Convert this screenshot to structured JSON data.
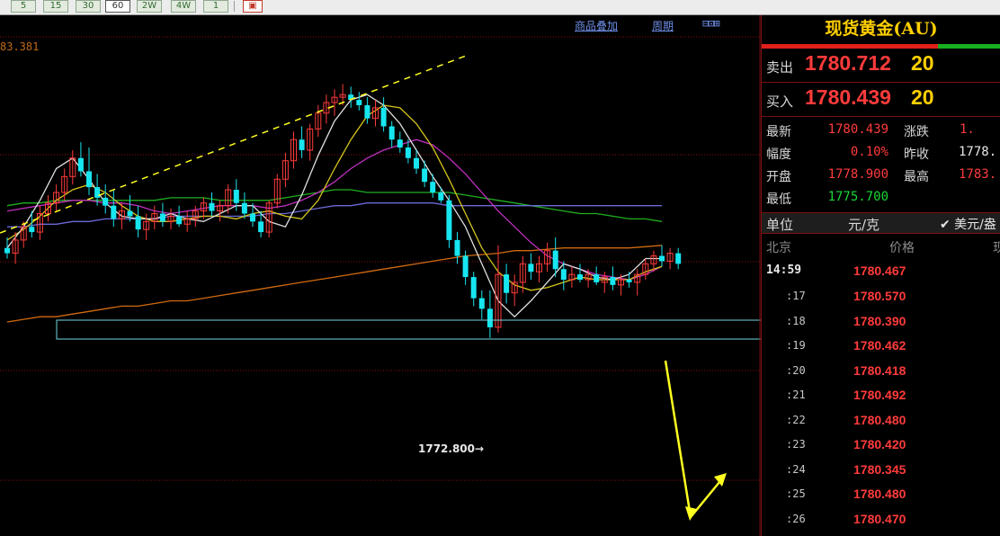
{
  "toolbar": {
    "periods": [
      "5",
      "15",
      "30",
      "60",
      "2W",
      "4W",
      "1"
    ],
    "selected": "60",
    "extra_icon": "screenshot-icon"
  },
  "chart": {
    "links": {
      "overlay": "商品叠加",
      "period": "周期"
    },
    "nav_glyphs": "⊟⊡⊞",
    "top_price_label": "83.381",
    "low_label": "1772.800→",
    "colors": {
      "up": "#ff3b3b",
      "down": "#17e6f0",
      "ma_white": "#e0e0e0",
      "ma_yellow": "#d4c41a",
      "ma_magenta": "#c030c0",
      "ma_green": "#20b020",
      "ma_blue": "#6a6ad8",
      "ma_orange": "#d06a10",
      "annotation_yellow": "#ffff20",
      "box": "#70d8e0",
      "grid": "#8a1010"
    }
  },
  "chart_data": {
    "type": "candlestick",
    "low_marker": 1772.8,
    "candles": [
      [
        1776.2,
        1776.6,
        1775.8,
        1776.0
      ],
      [
        1776.0,
        1776.8,
        1775.6,
        1776.5
      ],
      [
        1776.5,
        1777.2,
        1776.2,
        1777.0
      ],
      [
        1777.0,
        1777.6,
        1776.6,
        1776.8
      ],
      [
        1776.8,
        1777.8,
        1776.5,
        1777.5
      ],
      [
        1777.5,
        1778.2,
        1777.2,
        1777.9
      ],
      [
        1777.9,
        1778.6,
        1777.6,
        1778.3
      ],
      [
        1778.3,
        1779.2,
        1778.0,
        1778.9
      ],
      [
        1778.9,
        1779.9,
        1778.6,
        1779.6
      ],
      [
        1779.6,
        1780.2,
        1778.9,
        1779.1
      ],
      [
        1779.1,
        1780.0,
        1778.2,
        1778.5
      ],
      [
        1778.5,
        1779.0,
        1777.8,
        1778.1
      ],
      [
        1778.1,
        1778.6,
        1777.5,
        1777.8
      ],
      [
        1777.8,
        1778.4,
        1777.0,
        1777.3
      ],
      [
        1777.3,
        1777.9,
        1776.9,
        1777.6
      ],
      [
        1777.6,
        1778.2,
        1777.2,
        1777.4
      ],
      [
        1777.4,
        1777.8,
        1776.6,
        1776.9
      ],
      [
        1776.9,
        1777.5,
        1776.5,
        1777.2
      ],
      [
        1777.2,
        1777.8,
        1776.9,
        1777.5
      ],
      [
        1777.5,
        1777.9,
        1777.0,
        1777.2
      ],
      [
        1777.2,
        1777.7,
        1776.9,
        1777.4
      ],
      [
        1777.4,
        1777.8,
        1777.0,
        1777.1
      ],
      [
        1777.1,
        1777.6,
        1776.8,
        1777.3
      ],
      [
        1777.3,
        1777.8,
        1777.0,
        1777.6
      ],
      [
        1777.6,
        1778.1,
        1777.3,
        1777.9
      ],
      [
        1777.9,
        1778.3,
        1777.4,
        1777.6
      ],
      [
        1777.6,
        1778.0,
        1777.2,
        1777.8
      ],
      [
        1777.8,
        1778.6,
        1777.5,
        1778.4
      ],
      [
        1778.4,
        1778.8,
        1777.6,
        1777.9
      ],
      [
        1777.9,
        1778.3,
        1777.3,
        1777.5
      ],
      [
        1777.5,
        1777.9,
        1777.0,
        1777.2
      ],
      [
        1777.2,
        1777.6,
        1776.6,
        1776.8
      ],
      [
        1776.8,
        1778.0,
        1776.6,
        1777.9
      ],
      [
        1777.9,
        1779.0,
        1777.7,
        1778.8
      ],
      [
        1778.8,
        1779.8,
        1778.5,
        1779.5
      ],
      [
        1779.5,
        1780.6,
        1779.2,
        1780.3
      ],
      [
        1780.3,
        1780.8,
        1779.6,
        1779.9
      ],
      [
        1779.9,
        1780.9,
        1779.5,
        1780.7
      ],
      [
        1780.7,
        1781.6,
        1780.4,
        1781.3
      ],
      [
        1781.3,
        1782.0,
        1780.9,
        1781.7
      ],
      [
        1781.7,
        1782.2,
        1781.2,
        1781.9
      ],
      [
        1781.9,
        1782.4,
        1781.6,
        1782.0
      ],
      [
        1782.0,
        1782.3,
        1781.5,
        1781.8
      ],
      [
        1781.8,
        1782.1,
        1781.4,
        1781.6
      ],
      [
        1781.6,
        1781.9,
        1780.9,
        1781.1
      ],
      [
        1781.1,
        1781.8,
        1780.8,
        1781.5
      ],
      [
        1781.5,
        1781.9,
        1780.6,
        1780.8
      ],
      [
        1780.8,
        1781.0,
        1780.0,
        1780.3
      ],
      [
        1780.3,
        1780.6,
        1779.8,
        1780.0
      ],
      [
        1780.0,
        1780.3,
        1779.4,
        1779.6
      ],
      [
        1779.6,
        1779.9,
        1779.0,
        1779.2
      ],
      [
        1779.2,
        1779.5,
        1778.5,
        1778.7
      ],
      [
        1778.7,
        1779.0,
        1778.1,
        1778.3
      ],
      [
        1778.3,
        1778.5,
        1777.9,
        1778.0
      ],
      [
        1778.0,
        1778.2,
        1776.2,
        1776.5
      ],
      [
        1776.5,
        1776.8,
        1775.6,
        1775.9
      ],
      [
        1775.9,
        1776.1,
        1774.8,
        1775.1
      ],
      [
        1775.1,
        1775.3,
        1774.0,
        1774.3
      ],
      [
        1774.3,
        1774.6,
        1773.5,
        1773.9
      ],
      [
        1773.9,
        1774.6,
        1772.8,
        1773.2
      ],
      [
        1773.2,
        1776.3,
        1773.0,
        1775.2
      ],
      [
        1775.2,
        1775.6,
        1774.1,
        1774.5
      ],
      [
        1774.5,
        1775.2,
        1774.0,
        1774.9
      ],
      [
        1774.9,
        1775.9,
        1774.5,
        1775.6
      ],
      [
        1775.6,
        1776.0,
        1775.0,
        1775.3
      ],
      [
        1775.3,
        1775.9,
        1774.9,
        1775.6
      ],
      [
        1775.6,
        1776.4,
        1775.3,
        1776.1
      ],
      [
        1776.1,
        1776.6,
        1775.1,
        1775.4
      ],
      [
        1775.4,
        1775.7,
        1774.6,
        1775.0
      ],
      [
        1775.0,
        1775.5,
        1774.7,
        1775.2
      ],
      [
        1775.2,
        1775.6,
        1774.9,
        1775.0
      ],
      [
        1775.0,
        1775.4,
        1774.7,
        1775.2
      ],
      [
        1775.2,
        1775.5,
        1774.8,
        1774.9
      ],
      [
        1774.9,
        1775.3,
        1774.5,
        1775.1
      ],
      [
        1775.1,
        1775.5,
        1774.6,
        1774.8
      ],
      [
        1774.8,
        1775.2,
        1774.4,
        1775.0
      ],
      [
        1775.0,
        1775.3,
        1774.7,
        1774.9
      ],
      [
        1774.9,
        1775.4,
        1774.4,
        1775.2
      ],
      [
        1775.2,
        1775.8,
        1775.0,
        1775.6
      ],
      [
        1775.6,
        1776.1,
        1775.3,
        1775.9
      ],
      [
        1775.9,
        1776.3,
        1775.5,
        1775.7
      ],
      [
        1775.7,
        1776.2,
        1775.4,
        1776.0
      ],
      [
        1776.0,
        1776.2,
        1775.4,
        1775.6
      ]
    ],
    "ma_lines": [
      {
        "color_key": "ma_green",
        "values": [
          1777.8,
          1777.9,
          1777.9,
          1778.0,
          1778.0,
          1778.0,
          1778.0,
          1778.0,
          1778.0,
          1778.0,
          1778.1,
          1778.1,
          1778.1,
          1778.0,
          1778.0,
          1778.0,
          1778.0,
          1778.1,
          1778.2,
          1778.3,
          1778.4,
          1778.4,
          1778.3,
          1778.3,
          1778.3,
          1778.3,
          1778.3,
          1778.3,
          1778.2,
          1778.1,
          1778.0,
          1777.9,
          1777.8,
          1777.7,
          1777.6,
          1777.5,
          1777.5,
          1777.4,
          1777.3,
          1777.3,
          1777.2
        ]
      },
      {
        "color_key": "ma_blue",
        "values": [
          1777.0,
          1777.0,
          1777.1,
          1777.1,
          1777.2,
          1777.2,
          1777.3,
          1777.3,
          1777.3,
          1777.3,
          1777.4,
          1777.4,
          1777.4,
          1777.4,
          1777.4,
          1777.4,
          1777.5,
          1777.5,
          1777.6,
          1777.7,
          1777.8,
          1777.8,
          1777.9,
          1777.9,
          1777.9,
          1777.9,
          1777.9,
          1777.8,
          1777.8,
          1777.8,
          1777.8,
          1777.8,
          1777.8,
          1777.8,
          1777.8,
          1777.8,
          1777.8,
          1777.8,
          1777.8,
          1777.8,
          1777.8
        ]
      },
      {
        "color_key": "ma_orange",
        "values": [
          1773.4,
          1773.5,
          1773.6,
          1773.6,
          1773.7,
          1773.8,
          1773.9,
          1774.0,
          1774.0,
          1774.1,
          1774.2,
          1774.2,
          1774.3,
          1774.4,
          1774.5,
          1774.6,
          1774.7,
          1774.8,
          1774.9,
          1775.0,
          1775.1,
          1775.2,
          1775.3,
          1775.4,
          1775.5,
          1775.6,
          1775.7,
          1775.8,
          1775.9,
          1775.95,
          1776.0,
          1776.1,
          1776.1,
          1776.15,
          1776.2,
          1776.2,
          1776.2,
          1776.2,
          1776.2,
          1776.25,
          1776.3
        ]
      },
      {
        "color_key": "ma_magenta",
        "values": [
          1777.6,
          1777.7,
          1777.8,
          1777.9,
          1778.0,
          1778.0,
          1777.9,
          1777.9,
          1777.8,
          1777.6,
          1777.5,
          1777.6,
          1777.7,
          1777.8,
          1777.8,
          1777.8,
          1777.7,
          1777.8,
          1778.0,
          1778.3,
          1778.7,
          1779.2,
          1779.6,
          1779.9,
          1780.1,
          1780.3,
          1780.1,
          1779.6,
          1779.0,
          1778.3,
          1777.6,
          1777.0,
          1776.4,
          1775.9,
          1775.6,
          1775.4,
          1775.2,
          1775.1,
          1775.0,
          1775.2,
          1775.5
        ]
      },
      {
        "color_key": "ma_yellow",
        "values": [
          1776.5,
          1776.9,
          1777.4,
          1778.0,
          1778.4,
          1778.6,
          1778.3,
          1777.8,
          1777.4,
          1777.2,
          1777.2,
          1777.3,
          1777.4,
          1777.4,
          1777.3,
          1777.5,
          1777.6,
          1777.4,
          1777.3,
          1778.0,
          1779.2,
          1780.3,
          1781.2,
          1781.6,
          1781.5,
          1780.9,
          1780.0,
          1778.8,
          1777.5,
          1776.2,
          1775.3,
          1774.8,
          1774.6,
          1774.7,
          1774.9,
          1775.1,
          1775.0,
          1775.0,
          1775.0,
          1775.3,
          1775.5
        ]
      },
      {
        "color_key": "ma_white",
        "values": [
          1776.2,
          1777.0,
          1778.0,
          1779.2,
          1779.6,
          1778.8,
          1777.9,
          1777.4,
          1777.3,
          1777.3,
          1777.5,
          1777.3,
          1777.2,
          1777.5,
          1777.8,
          1777.8,
          1777.2,
          1777.0,
          1778.2,
          1779.7,
          1781.0,
          1781.8,
          1782.0,
          1781.6,
          1780.9,
          1779.9,
          1778.9,
          1778.0,
          1777.0,
          1775.6,
          1774.2,
          1773.6,
          1774.2,
          1774.9,
          1775.6,
          1775.4,
          1775.1,
          1775.0,
          1775.2,
          1775.8,
          1775.8
        ]
      }
    ]
  },
  "panel": {
    "title": "现货黄金(AU)",
    "sell_label": "卖出",
    "sell_price": "1780.712",
    "sell_vol": "20",
    "buy_label": "买入",
    "buy_price": "1780.439",
    "buy_vol": "20",
    "stats": {
      "latest_label": "最新",
      "latest": "1780.439",
      "change_label": "涨跌",
      "change": "1.",
      "range_label": "幅度",
      "range": "0.10%",
      "prev_label": "昨收",
      "prev": "1778.",
      "open_label": "开盘",
      "open": "1778.900",
      "high_label": "最高",
      "high": "1783.",
      "low_label": "最低",
      "low": "1775.700"
    },
    "unit_label": "单位",
    "unit_value": "元/克",
    "alt_unit": "✔ 美元/盎",
    "col_city": "北京",
    "col_price": "价格",
    "col_extra": "现",
    "ticks": [
      {
        "time": "14:59",
        "price": "1780.467"
      },
      {
        "time": ":17",
        "price": "1780.570"
      },
      {
        "time": ":18",
        "price": "1780.390"
      },
      {
        "time": ":19",
        "price": "1780.462"
      },
      {
        "time": ":20",
        "price": "1780.418"
      },
      {
        "time": ":21",
        "price": "1780.492"
      },
      {
        "time": ":22",
        "price": "1780.480"
      },
      {
        "time": ":23",
        "price": "1780.420"
      },
      {
        "time": ":24",
        "price": "1780.345"
      },
      {
        "time": ":25",
        "price": "1780.480"
      },
      {
        "time": ":26",
        "price": "1780.470"
      }
    ]
  }
}
